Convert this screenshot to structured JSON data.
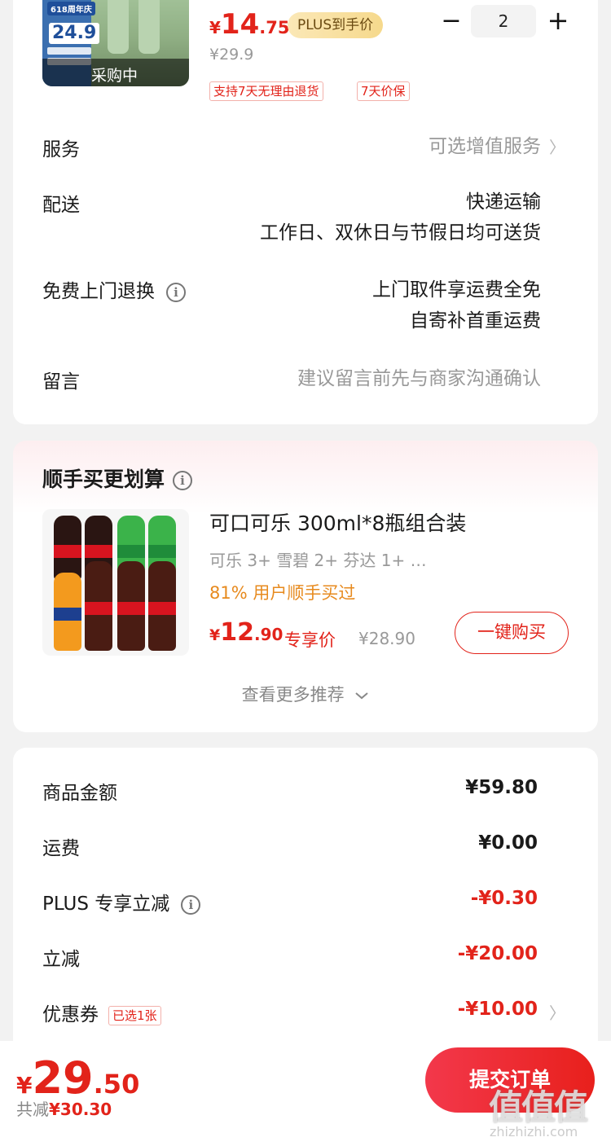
{
  "product": {
    "thumb_badge": "618周年庆",
    "thumb_number": "24.9",
    "thumb_status": "采购中",
    "price_currency": "¥",
    "price_int": "14",
    "price_dec": ".75",
    "plus_tag": "PLUS到手价",
    "original_price": "¥29.9",
    "quantity": "2",
    "minus_label": "−",
    "plus_label": "+",
    "tags": [
      "支持7天无理由退货",
      "7天价保"
    ]
  },
  "rows": {
    "service_label": "服务",
    "service_value": "可选增值服务",
    "delivery_label": "配送",
    "delivery_line1": "快递运输",
    "delivery_line2": "工作日、双休日与节假日均可送货",
    "return_label": "免费上门退换",
    "return_line1": "上门取件享运费全免",
    "return_line2": "自寄补首重运费",
    "message_label": "留言",
    "message_placeholder": "建议留言前先与商家沟通确认"
  },
  "addon": {
    "title": "顺手买更划算",
    "name": "可口可乐 300ml*8瓶组合装",
    "subtitle": "可乐 3+ 雪碧 2+ 芬达 1+ …",
    "percent": "81% 用户顺手买过",
    "price_currency": "¥",
    "price_int": "12",
    "price_dec": ".90",
    "exclusive": "专享价",
    "original_price": "¥28.90",
    "buy_button": "一键购买",
    "more": "查看更多推荐"
  },
  "summary": {
    "goods_label": "商品金额",
    "goods_value": "¥59.80",
    "shipping_label": "运费",
    "shipping_value": "¥0.00",
    "plus_label": "PLUS 专享立减",
    "plus_value": "-¥0.30",
    "instant_label": "立减",
    "instant_value": "-¥20.00",
    "coupon_label": "优惠券",
    "coupon_tag": "已选1张",
    "coupon_value": "-¥10.00"
  },
  "footer": {
    "total_currency": "¥",
    "total_int": "29",
    "total_dec": ".50",
    "saved_prefix": "共减",
    "saved_value": "¥30.30",
    "submit": "提交订单",
    "watermark": "值值值",
    "watermark_url": "zhizhizhi.com"
  },
  "colors": {
    "accent_red": "#e2231a",
    "plus_gold": "#f6d98c",
    "orange": "#e78a1e"
  }
}
